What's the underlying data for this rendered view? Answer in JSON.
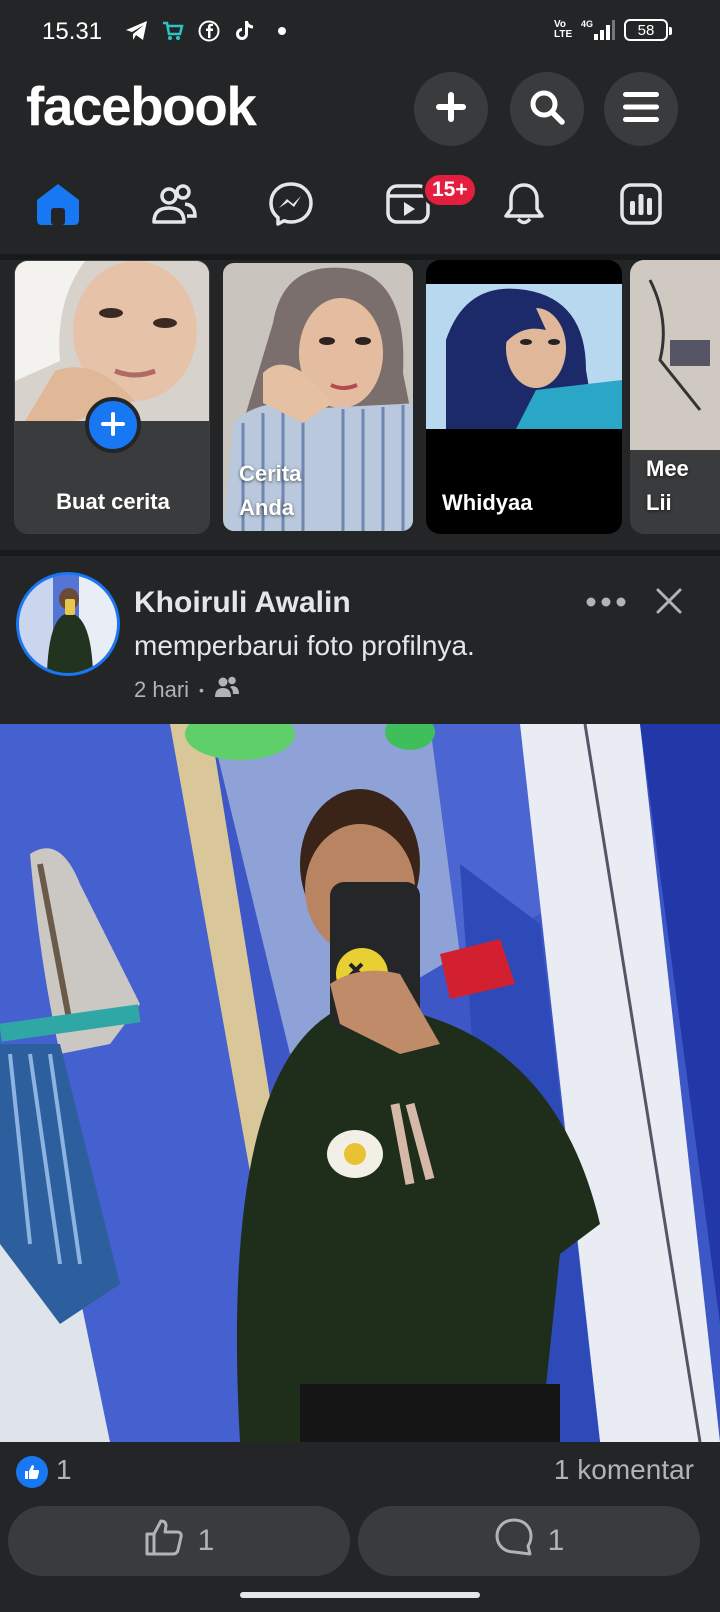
{
  "status_bar": {
    "time": "15.31",
    "volte": "Vo LTE",
    "network": "4G",
    "battery": "58"
  },
  "header": {
    "logo": "facebook"
  },
  "nav": {
    "video_badge": "15+"
  },
  "stories": [
    {
      "label": "Buat cerita"
    },
    {
      "label": "Cerita\nAnda"
    },
    {
      "label": "Whidyaa"
    },
    {
      "label": "Mee\nLii"
    }
  ],
  "post": {
    "author": "Khoiruli Awalin",
    "action": "memperbarui foto profilnya.",
    "time": "2 hari",
    "like_count": "1",
    "comment_summary": "1 komentar",
    "like_button_count": "1",
    "comment_button_count": "1"
  },
  "colors": {
    "background": "#242526",
    "accent": "#1877f2",
    "badge": "#e41e3f"
  }
}
